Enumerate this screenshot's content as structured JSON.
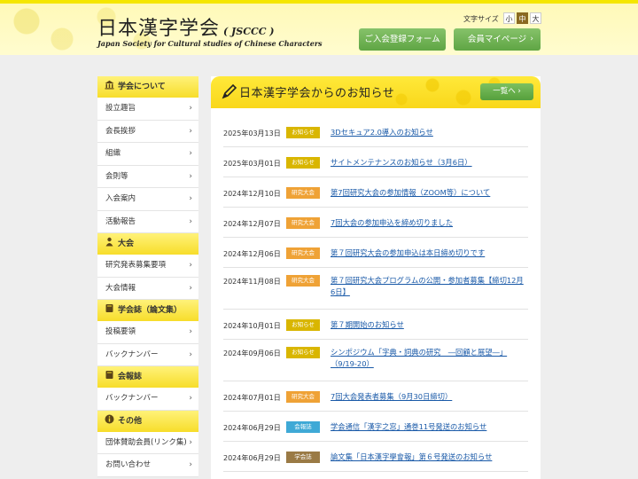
{
  "header": {
    "title": "日本漢字学会",
    "abbr": "( JSCCC )",
    "subtitle": "Japan Society for Cultural studies of Chinese Characters",
    "font_size_label": "文字サイズ",
    "font_sizes": [
      "小",
      "中",
      "大"
    ],
    "register_button": "ご入会登録フォーム",
    "mypage_button": "会員マイページ"
  },
  "sidebar": {
    "sections": [
      {
        "heading": "学会について",
        "icon": "building-icon",
        "items": [
          "設立趣旨",
          "会長挨拶",
          "組織",
          "会則等",
          "入会案内",
          "活動報告"
        ]
      },
      {
        "heading": "大会",
        "icon": "person-icon",
        "items": [
          "研究発表募集要項",
          "大会情報"
        ]
      },
      {
        "heading": "学会誌（論文集）",
        "icon": "book-icon",
        "items": [
          "投稿要領",
          "バックナンバー"
        ]
      },
      {
        "heading": "会報誌",
        "icon": "book-icon",
        "items": [
          "バックナンバー"
        ]
      },
      {
        "heading": "その他",
        "icon": "info-icon",
        "items": [
          "団体賛助会員(リンク集)",
          "お問い合わせ"
        ]
      }
    ]
  },
  "news": {
    "title": "日本漢字学会からのお知らせ",
    "more_button": "一覧へ",
    "colors": {
      "お知らせ": "#d9b600",
      "研究大会": "#efa236",
      "会報誌": "#3fa9d6",
      "学会誌": "#9a7a45"
    },
    "items": [
      {
        "date": "2025年03月13日",
        "tag": "お知らせ",
        "text": "3Dセキュア2.0導入のお知らせ"
      },
      {
        "date": "2025年03月01日",
        "tag": "お知らせ",
        "text": "サイトメンテナンスのお知らせ（3月6日）"
      },
      {
        "date": "2024年12月10日",
        "tag": "研究大会",
        "text": "第7回研究大会の参加情報（ZOOM等）について"
      },
      {
        "date": "2024年12月07日",
        "tag": "研究大会",
        "text": "7回大会の参加申込を締め切りました"
      },
      {
        "date": "2024年12月06日",
        "tag": "研究大会",
        "text": "第７回研究大会の参加申込は本日締め切りです"
      },
      {
        "date": "2024年11月08日",
        "tag": "研究大会",
        "text": "第７回研究大会プログラムの公開・参加者募集【締切12月6日】"
      },
      {
        "date": "2024年10月01日",
        "tag": "お知らせ",
        "text": "第７期開始のお知らせ"
      },
      {
        "date": "2024年09月06日",
        "tag": "お知らせ",
        "text": "シンポジウム「字典・詞典の研究　―回顧と展望―」（9/19-20）"
      },
      {
        "date": "2024年07月01日",
        "tag": "研究大会",
        "text": "7回大会発表者募集（9月30日締切）"
      },
      {
        "date": "2024年06月29日",
        "tag": "会報誌",
        "text": "学会通信「漢字之窓」通巻11号発送のお知らせ"
      },
      {
        "date": "2024年06月29日",
        "tag": "学会誌",
        "text": "論文集「日本漢字學會報」第６号発送のお知らせ"
      }
    ]
  }
}
